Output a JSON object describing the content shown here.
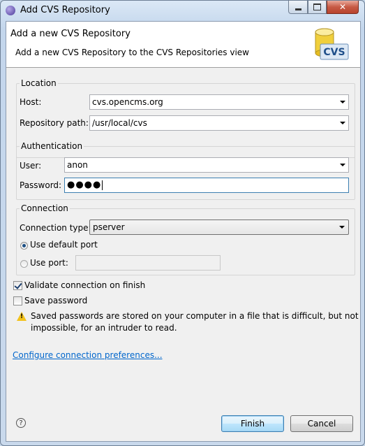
{
  "window": {
    "title": "Add CVS Repository",
    "icon": "eclipse-app-icon",
    "controls": {
      "minimize_icon": "minimize-icon",
      "maximize_icon": "maximize-icon",
      "close_glyph": "✕"
    }
  },
  "banner": {
    "title": "Add a new CVS Repository",
    "description": "Add a new CVS Repository to the CVS Repositories view",
    "icon_label": "CVS"
  },
  "location": {
    "legend": "Location",
    "host_label": "Host:",
    "host_value": "cvs.opencms.org",
    "path_label": "Repository path:",
    "path_value": "/usr/local/cvs"
  },
  "authentication": {
    "legend": "Authentication",
    "user_label": "User:",
    "user_value": "anon",
    "password_label": "Password:",
    "password_mask": "●●●●"
  },
  "connection": {
    "legend": "Connection",
    "type_label": "Connection type:",
    "type_value": "pserver",
    "default_port_label": "Use default port",
    "default_port_selected": true,
    "use_port_label": "Use port:",
    "use_port_value": ""
  },
  "options": {
    "validate_label": "Validate connection on finish",
    "validate_checked": true,
    "save_password_label": "Save password",
    "save_password_checked": false,
    "warning_text": "Saved passwords are stored on your computer in a file that is difficult, but not impossible, for an intruder to read."
  },
  "link_text": "Configure connection preferences...",
  "footer": {
    "help_glyph": "?",
    "finish_label": "Finish",
    "cancel_label": "Cancel"
  },
  "colors": {
    "accent": "#3c7fb1",
    "link": "#0066cc",
    "warning": "#f2c21c",
    "close_button": "#c75a44"
  }
}
